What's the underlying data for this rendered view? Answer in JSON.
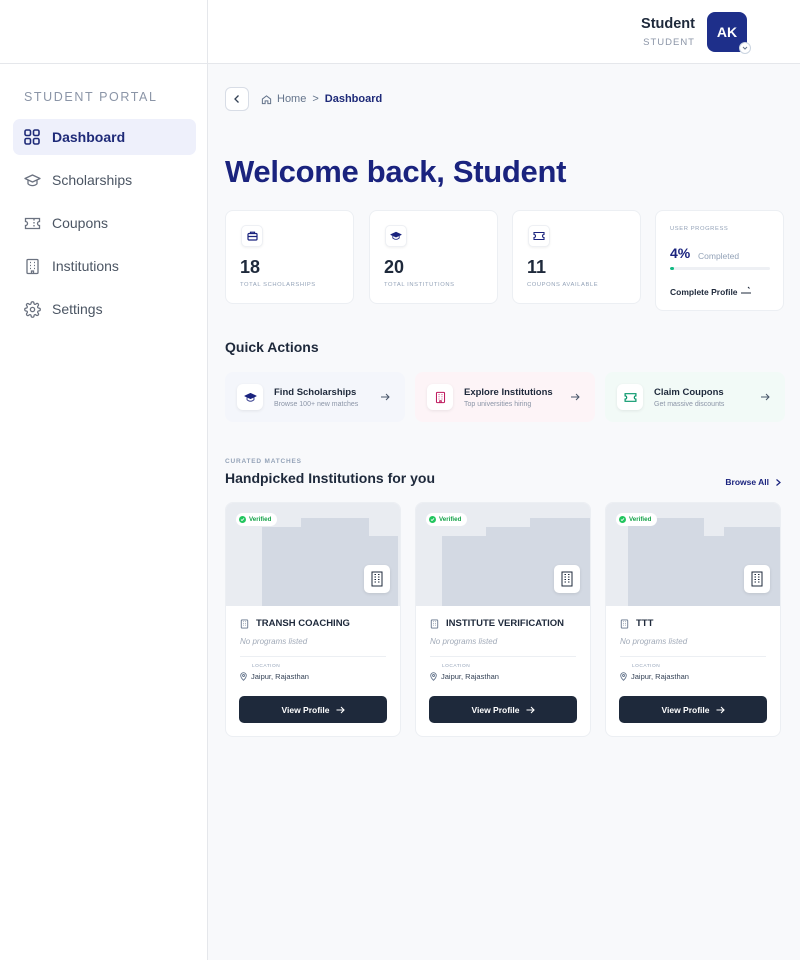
{
  "header": {
    "user_name": "Student",
    "user_role": "STUDENT",
    "avatar_initials": "AK"
  },
  "sidebar": {
    "portal_label": "STUDENT PORTAL",
    "items": [
      {
        "label": "Dashboard",
        "icon": "grid-icon",
        "active": true
      },
      {
        "label": "Scholarships",
        "icon": "graduation-cap-icon",
        "active": false
      },
      {
        "label": "Coupons",
        "icon": "ticket-icon",
        "active": false
      },
      {
        "label": "Institutions",
        "icon": "building-icon",
        "active": false
      },
      {
        "label": "Settings",
        "icon": "gear-icon",
        "active": false
      }
    ]
  },
  "breadcrumb": {
    "home": "Home",
    "separator": ">",
    "current": "Dashboard"
  },
  "welcome": "Welcome back, Student",
  "stats": [
    {
      "value": "18",
      "label": "TOTAL SCHOLARSHIPS",
      "icon": "briefcase-icon"
    },
    {
      "value": "20",
      "label": "TOTAL INSTITUTIONS",
      "icon": "graduation-cap-icon"
    },
    {
      "value": "11",
      "label": "COUPONS AVAILABLE",
      "icon": "ticket-icon"
    }
  ],
  "progress": {
    "title": "USER PROGRESS",
    "percent_text": "4%",
    "percent_value": 0.04,
    "completed_label": "Completed",
    "action": "Complete Profile"
  },
  "quick_actions": {
    "title": "Quick Actions",
    "items": [
      {
        "title": "Find Scholarships",
        "subtitle": "Browse 100+ new matches",
        "icon": "graduation-cap-icon",
        "bg": "#f4f6fb",
        "accent": "#1a237e"
      },
      {
        "title": "Explore Institutions",
        "subtitle": "Top universities hiring",
        "icon": "building-icon",
        "bg": "#fdf4f7",
        "accent": "#be185d"
      },
      {
        "title": "Claim Coupons",
        "subtitle": "Get massive discounts",
        "icon": "ticket-icon",
        "bg": "#f2faf7",
        "accent": "#059669"
      }
    ]
  },
  "curated": {
    "eyebrow": "CURATED MATCHES",
    "title": "Handpicked Institutions for you",
    "browse_all": "Browse All"
  },
  "institutions": [
    {
      "name": "TRANSH COACHING",
      "programs": "No programs listed",
      "location_label": "LOCATION",
      "location": "Jaipur, Rajasthan",
      "verified": "Verified",
      "button": "View Profile"
    },
    {
      "name": "INSTITUTE VERIFICATION",
      "programs": "No programs listed",
      "location_label": "LOCATION",
      "location": "Jaipur, Rajasthan",
      "verified": "Verified",
      "button": "View Profile"
    },
    {
      "name": "TTT",
      "programs": "No programs listed",
      "location_label": "LOCATION",
      "location": "Jaipur, Rajasthan",
      "verified": "Verified",
      "button": "View Profile"
    }
  ],
  "colors": {
    "primary": "#1a237e",
    "avatar_bg": "#1e2f8a",
    "button_dark": "#1e293b",
    "success": "#22c55e"
  }
}
